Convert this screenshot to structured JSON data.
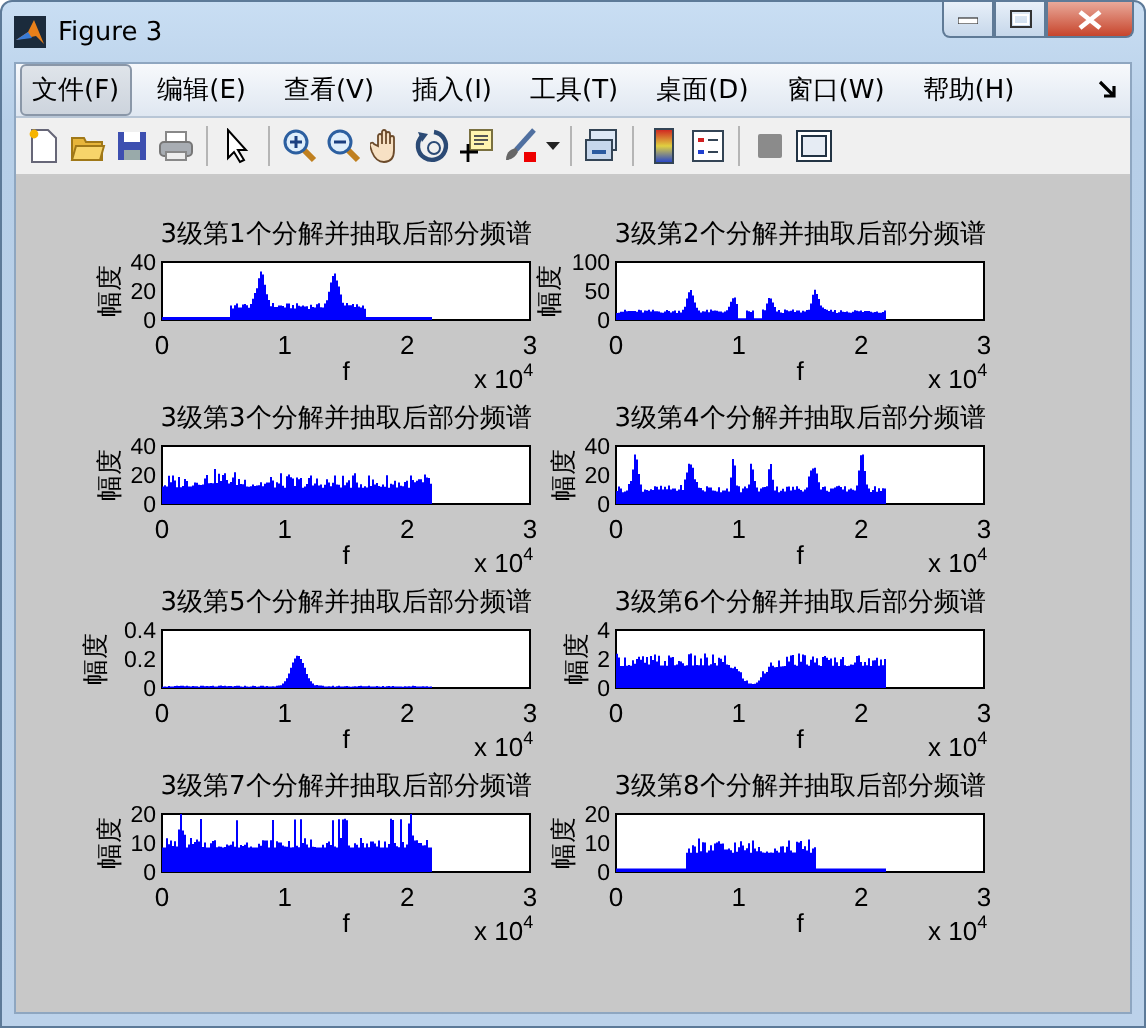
{
  "window": {
    "title": "Figure 3"
  },
  "menu": [
    {
      "label": "文件(F)",
      "selected": true
    },
    {
      "label": "编辑(E)",
      "selected": false
    },
    {
      "label": "查看(V)",
      "selected": false
    },
    {
      "label": "插入(I)",
      "selected": false
    },
    {
      "label": "工具(T)",
      "selected": false
    },
    {
      "label": "桌面(D)",
      "selected": false
    },
    {
      "label": "窗口(W)",
      "selected": false
    },
    {
      "label": "帮助(H)",
      "selected": false
    }
  ],
  "plots": [
    {
      "title": "3级第1个分解并抽取后部分频谱",
      "ylabel": "幅度",
      "yticks": [
        "40",
        "20",
        "0"
      ],
      "xticks": [
        "0",
        "1",
        "2",
        "3"
      ],
      "xlabel": "f",
      "x_multiplier": "x 10$^{4}$"
    },
    {
      "title": "3级第2个分解并抽取后部分频谱",
      "ylabel": "幅度",
      "yticks": [
        "100",
        "50",
        "0"
      ],
      "xticks": [
        "0",
        "1",
        "2",
        "3"
      ],
      "xlabel": "f",
      "x_multiplier": "x 10$^{4}$"
    },
    {
      "title": "3级第3个分解并抽取后部分频谱",
      "ylabel": "幅度",
      "yticks": [
        "40",
        "20",
        "0"
      ],
      "xticks": [
        "0",
        "1",
        "2",
        "3"
      ],
      "xlabel": "f",
      "x_multiplier": "x 10$^{4}$"
    },
    {
      "title": "3级第4个分解并抽取后部分频谱",
      "ylabel": "幅度",
      "yticks": [
        "40",
        "20",
        "0"
      ],
      "xticks": [
        "0",
        "1",
        "2",
        "3"
      ],
      "xlabel": "f",
      "x_multiplier": "x 10$^{4}$"
    },
    {
      "title": "3级第5个分解并抽取后部分频谱",
      "ylabel": "幅度",
      "yticks": [
        "0.4",
        "0.2",
        "0"
      ],
      "xticks": [
        "0",
        "1",
        "2",
        "3"
      ],
      "xlabel": "f",
      "x_multiplier": "x 10$^{4}$"
    },
    {
      "title": "3级第6个分解并抽取后部分频谱",
      "ylabel": "幅度",
      "yticks": [
        "4",
        "2",
        "0"
      ],
      "xticks": [
        "0",
        "1",
        "2",
        "3"
      ],
      "xlabel": "f",
      "x_multiplier": "x 10$^{4}$"
    },
    {
      "title": "3级第7个分解并抽取后部分频谱",
      "ylabel": "幅度",
      "yticks": [
        "20",
        "10",
        "0"
      ],
      "xticks": [
        "0",
        "1",
        "2",
        "3"
      ],
      "xlabel": "f",
      "x_multiplier": "x 10$^{4}$"
    },
    {
      "title": "3级第8个分解并抽取后部分频谱",
      "ylabel": "幅度",
      "yticks": [
        "20",
        "10",
        "0"
      ],
      "xticks": [
        "0",
        "1",
        "2",
        "3"
      ],
      "xlabel": "f",
      "x_multiplier": "x 10$^{4}$"
    }
  ]
}
